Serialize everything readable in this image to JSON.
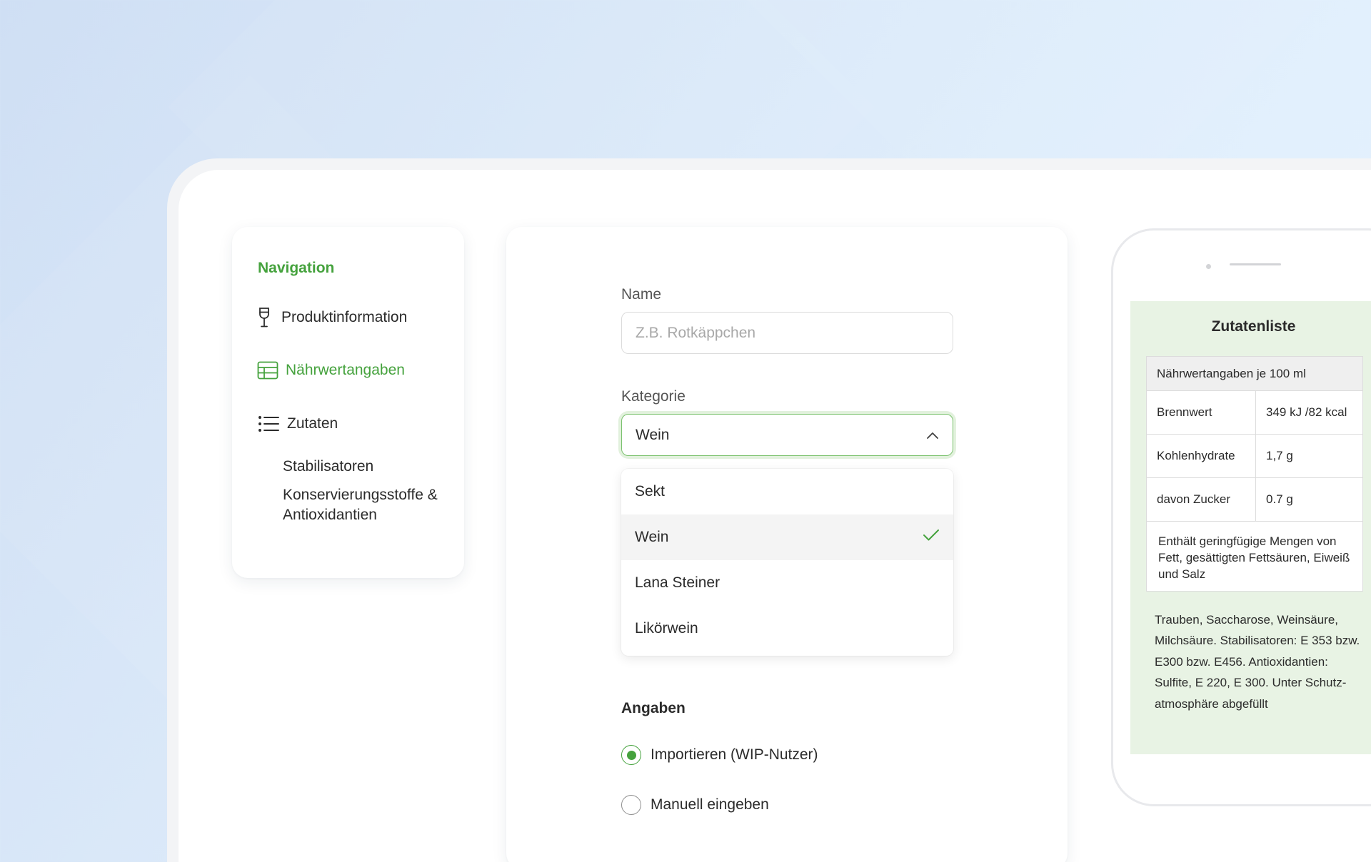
{
  "navigation": {
    "title": "Navigation",
    "items": [
      {
        "label": "Produktinformation",
        "icon": "wine-glass-icon"
      },
      {
        "label": "Nährwertangaben",
        "icon": "table-icon",
        "active": true
      },
      {
        "label": "Zutaten",
        "icon": "list-icon"
      }
    ],
    "subitems": [
      "Stabilisatoren",
      "Konservierungsstoffe & Antioxidantien"
    ]
  },
  "form": {
    "name_label": "Name",
    "name_placeholder": "Z.B. Rotkäppchen",
    "name_value": "",
    "category_label": "Kategorie",
    "category_value": "Wein",
    "category_options": [
      "Sekt",
      "Wein",
      "Lana Steiner",
      "Likörwein"
    ],
    "category_selected": "Wein",
    "section_title": "Angaben",
    "radio_import": "Importieren (WIP-Nutzer)",
    "radio_manual": "Manuell eingeben",
    "radio_selected": "import"
  },
  "preview": {
    "title": "Zutatenliste",
    "table_header": "Nährwertangaben je 100 ml",
    "rows": [
      {
        "label": "Brennwert",
        "value": "349 kJ /82 kcal"
      },
      {
        "label": "Kohlenhydrate",
        "value": "1,7 g"
      },
      {
        "label": "davon Zucker",
        "value": "0.7 g"
      }
    ],
    "note": "Enthält geringfügige Mengen von Fett, gesättigten Fettsäuren, Eiweiß und Salz",
    "ingredients": "Trauben, Saccharose, Weinsäure, Milchsäure. Stabilisatoren: E 353 bzw. E300 bzw. E456. Antioxidantien: Sulfite, E 220, E 300. Unter Schutz-atmosphäre abgefüllt"
  },
  "colors": {
    "accent": "#45a23d",
    "preview_bg": "#e8f3e4",
    "background": "#dbe9f9"
  }
}
